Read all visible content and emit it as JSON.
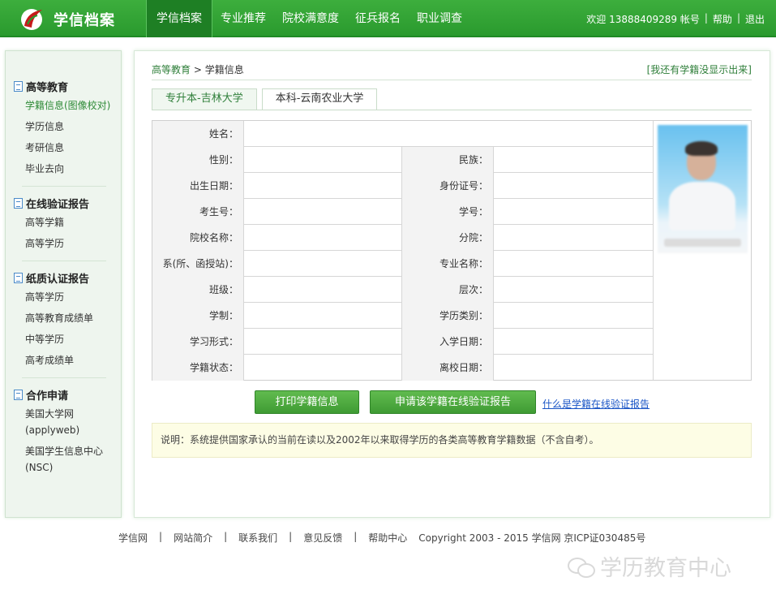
{
  "header": {
    "logo_text": "学信档案",
    "nav": [
      "学信档案",
      "专业推荐",
      "院校满意度",
      "征兵报名",
      "职业调查"
    ],
    "welcome": "欢迎 13888409289 帐号",
    "help": "帮助",
    "logout": "退出",
    "sep": "|"
  },
  "sidebar": {
    "groups": [
      {
        "title": "高等教育",
        "items": [
          "学籍信息(图像校对)",
          "学历信息",
          "考研信息",
          "毕业去向"
        ]
      },
      {
        "title": "在线验证报告",
        "items": [
          "高等学籍",
          "高等学历"
        ]
      },
      {
        "title": "纸质认证报告",
        "items": [
          "高等学历",
          "高等教育成绩单",
          "中等学历",
          "高考成绩单"
        ]
      },
      {
        "title": "合作申请",
        "items": [
          "美国大学网\n(applyweb)",
          "美国学生信息中心\n(NSC)"
        ]
      }
    ]
  },
  "main": {
    "breadcrumb": {
      "parent": "高等教育",
      "sep": ">",
      "current": "学籍信息"
    },
    "missing_link": "[我还有学籍没显示出来]",
    "tabs": [
      "专升本-吉林大学",
      "本科-云南农业大学"
    ],
    "fields": {
      "name": "姓名：",
      "gender": "性别：",
      "ethnicity": "民族：",
      "birthdate": "出生日期：",
      "id_number": "身份证号：",
      "exam_number": "考生号：",
      "student_number": "学号：",
      "school": "院校名称：",
      "branch": "分院：",
      "department": "系(所、函授站)：",
      "major": "专业名称：",
      "class": "班级：",
      "level": "层次：",
      "duration": "学制：",
      "education_type": "学历类别：",
      "study_form": "学习形式：",
      "enroll_date": "入学日期：",
      "status": "学籍状态：",
      "leave_date": "离校日期："
    },
    "buttons": {
      "print": "打印学籍信息",
      "apply": "申请该学籍在线验证报告"
    },
    "what_link": "什么是学籍在线验证报告",
    "note": "说明：系统提供国家承认的当前在读以及2002年以来取得学历的各类高等教育学籍数据（不含自考）。"
  },
  "footer": {
    "links": [
      "学信网",
      "网站简介",
      "联系我们",
      "意见反馈",
      "帮助中心"
    ],
    "sep": "|",
    "copyright": "Copyright 2003 - 2015  学信网  京ICP证030485号"
  },
  "watermark": "学历教育中心",
  "colors": {
    "brand": "#2a9a2e",
    "link": "#2f7f3a",
    "button": "#3f9b34"
  }
}
